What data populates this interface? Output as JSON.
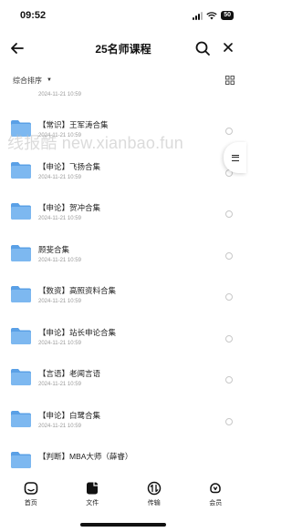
{
  "status_bar": {
    "time": "09:52",
    "battery": "50"
  },
  "nav": {
    "title": "25名师课程"
  },
  "toolbar": {
    "sort_label": "综合排序"
  },
  "partial_date": "2024-11-21 10:59",
  "files": [
    {
      "name": "【常识】王军涛合集",
      "date": "2024-11-21 10:59"
    },
    {
      "name": "【申论】飞扬合集",
      "date": "2024-11-21 10:59"
    },
    {
      "name": "【申论】贺冲合集",
      "date": "2024-11-21 10:59"
    },
    {
      "name": "顾斐合集",
      "date": "2024-11-21 10:59"
    },
    {
      "name": "【数资】高照资料合集",
      "date": "2024-11-21 10:59"
    },
    {
      "name": "【申论】站长申论合集",
      "date": "2024-11-21 10:59"
    },
    {
      "name": "【言语】老闻言语",
      "date": "2024-11-21 10:59"
    },
    {
      "name": "【申论】白鹭合集",
      "date": "2024-11-21 10:59"
    },
    {
      "name": "【判断】MBA大师（薛睿）",
      "date": ""
    }
  ],
  "watermark": "线报酷 new.xianbao.fun",
  "tabs": [
    {
      "label": "首页",
      "icon": "home-face-icon"
    },
    {
      "label": "文件",
      "icon": "file-icon"
    },
    {
      "label": "传输",
      "icon": "transfer-icon"
    },
    {
      "label": "会员",
      "icon": "vip-icon"
    }
  ],
  "colors": {
    "folder": "#7db8f0",
    "folder_dark": "#5aa0e6"
  }
}
